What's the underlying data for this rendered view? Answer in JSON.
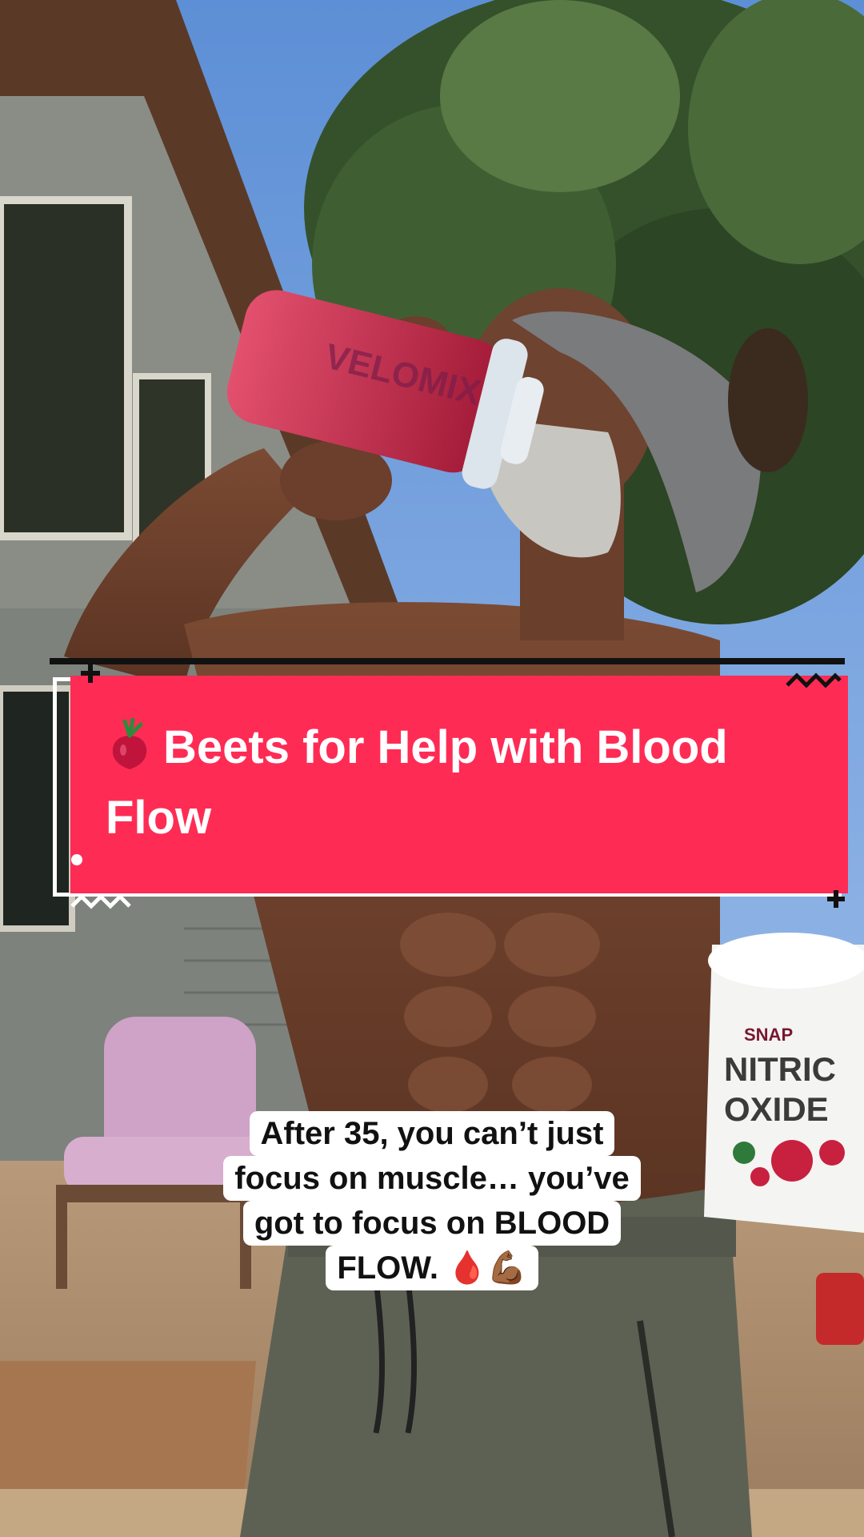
{
  "banner": {
    "icon": "beet-icon",
    "title": "Beets for Help with Blood Flow",
    "colors": {
      "background": "#fe2c55",
      "text": "#ffffff",
      "frame": "#ffffff"
    }
  },
  "caption": {
    "lines": [
      "After 35, you can’t just",
      "focus on muscle… you’ve",
      "got to focus on BLOOD",
      "FLOW. 🩸💪🏾"
    ]
  },
  "product": {
    "brand": "SNAP",
    "name_line1": "NITRIC",
    "name_line2": "OXIDE"
  },
  "bottle": {
    "brand": "VELOMIX"
  }
}
